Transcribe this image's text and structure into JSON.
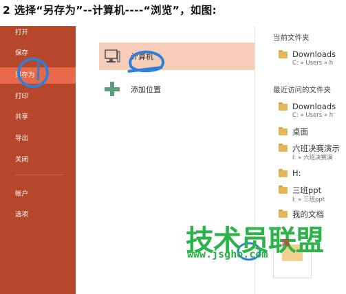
{
  "caption": "2 选择“另存为”--计算机----“浏览”，如图:",
  "sidebar": {
    "items": [
      {
        "label": "打开"
      },
      {
        "label": "保存"
      },
      {
        "label": "另存为"
      },
      {
        "label": "打印"
      },
      {
        "label": "共享"
      },
      {
        "label": "导出"
      },
      {
        "label": "关闭"
      },
      {
        "label": "帐户"
      },
      {
        "label": "选项"
      }
    ]
  },
  "middle": {
    "computer_label": "计算机",
    "add_location_label": "添加位置"
  },
  "right": {
    "current_folder_heading": "当前文件夹",
    "current": [
      {
        "name": "Downloads",
        "path": "C: » Users » h"
      }
    ],
    "recent_heading": "最近访问的文件夹",
    "recent": [
      {
        "name": "Downloads",
        "path": "C: » Users » h"
      },
      {
        "name": "桌面",
        "path": ""
      },
      {
        "name": "六班决赛演示",
        "path": "I: » 六班决赛演"
      },
      {
        "name": "H:",
        "path": ""
      },
      {
        "name": "三班ppt",
        "path": "I: » 三班ppt"
      },
      {
        "name": "我的文档",
        "path": ""
      }
    ]
  },
  "watermark": {
    "main": "技术员联盟",
    "red": "网",
    "url": "www.jsgho.com"
  },
  "colors": {
    "sidebar": "#b7472a",
    "sidebar_active": "#e8684a",
    "selected_row": "#f5cdb8",
    "annotation": "#2f7fd8",
    "watermark": "#2cb34a"
  }
}
